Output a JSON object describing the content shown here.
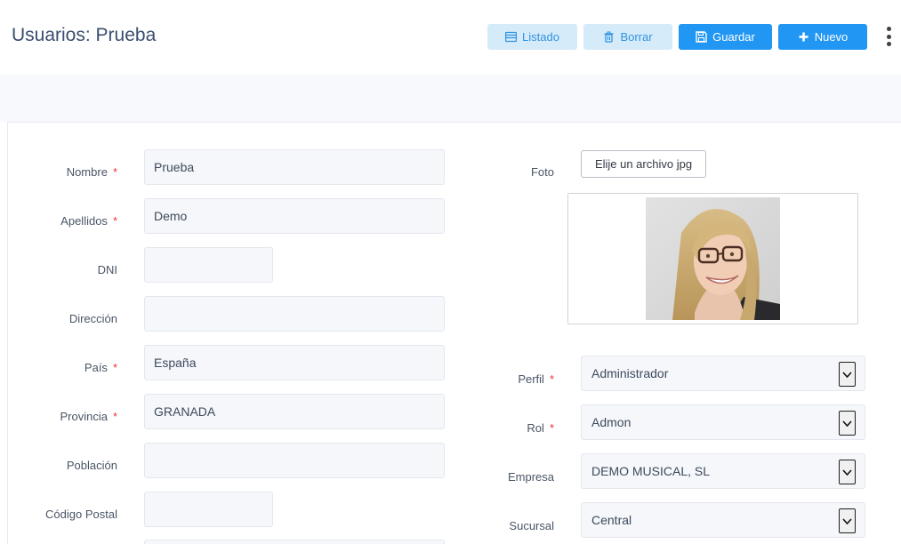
{
  "header": {
    "title": "Usuarios: Prueba",
    "buttons": {
      "listado": "Listado",
      "borrar": "Borrar",
      "guardar": "Guardar",
      "nuevo": "Nuevo"
    }
  },
  "form": {
    "required_mark": "*",
    "fields": {
      "nombre": {
        "label": "Nombre",
        "value": "Prueba"
      },
      "apellidos": {
        "label": "Apellidos",
        "value": "Demo"
      },
      "dni": {
        "label": "DNI",
        "value": ""
      },
      "direccion": {
        "label": "Dirección",
        "value": ""
      },
      "pais": {
        "label": "País",
        "value": "España"
      },
      "provincia": {
        "label": "Provincia",
        "value": "GRANADA"
      },
      "poblacion": {
        "label": "Población",
        "value": ""
      },
      "codigo_postal": {
        "label": "Código Postal",
        "value": ""
      }
    },
    "foto": {
      "label": "Foto",
      "button": "Elije un archivo jpg"
    },
    "selects": {
      "perfil": {
        "label": "Perfil",
        "value": "Administrador"
      },
      "rol": {
        "label": "Rol",
        "value": "Admon"
      },
      "empresa": {
        "label": "Empresa",
        "value": "DEMO MUSICAL, SL"
      },
      "sucursal": {
        "label": "Sucursal",
        "value": "Central"
      }
    }
  },
  "colors": {
    "primary": "#2196f3",
    "light_button": "#d6ebf9",
    "title": "#3a4e6e",
    "required": "#e53935"
  }
}
